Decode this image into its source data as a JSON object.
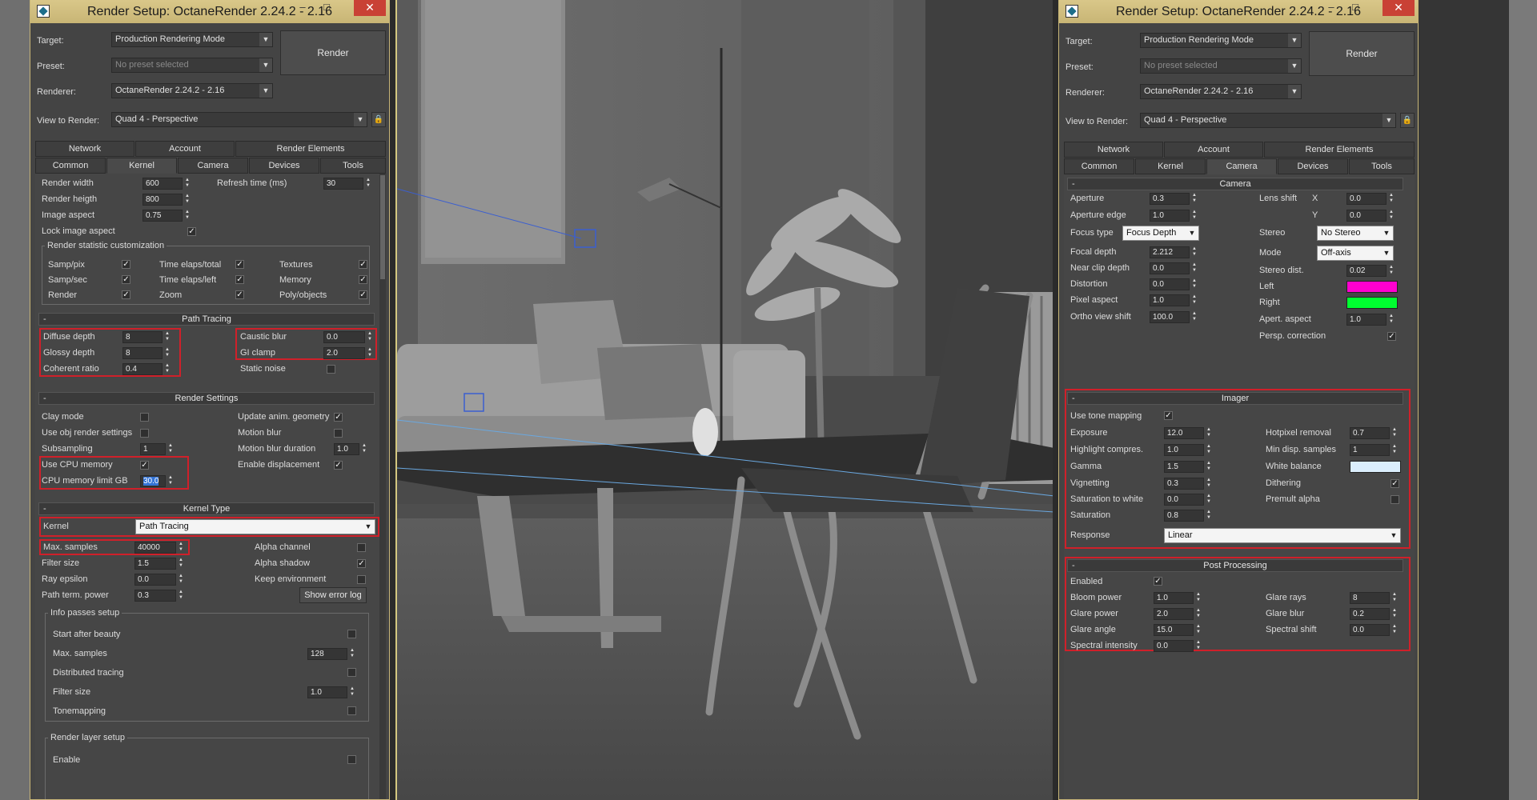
{
  "left_window": {
    "title": "Render Setup: OctaneRender 2.24.2 - 2.16",
    "target_label": "Target:",
    "target_value": "Production Rendering Mode",
    "preset_label": "Preset:",
    "preset_value": "No preset selected",
    "renderer_label": "Renderer:",
    "renderer_value": "OctaneRender 2.24.2 - 2.16",
    "view_label": "View to Render:",
    "view_value": "Quad 4 - Perspective",
    "render_button": "Render",
    "tabs_row1": [
      "Network",
      "Account",
      "Render Elements"
    ],
    "tabs_row2": [
      "Common",
      "Kernel",
      "Camera",
      "Devices",
      "Tools"
    ],
    "active_tab": "Kernel",
    "render_width_label": "Render width",
    "render_width": "600",
    "render_height_label": "Render heigth",
    "render_height": "800",
    "image_aspect_label": "Image aspect",
    "image_aspect": "0.75",
    "lock_aspect_label": "Lock image aspect",
    "refresh_label": "Refresh time (ms)",
    "refresh_value": "30",
    "stat_group_title": "Render statistic customization",
    "stat_items": [
      "Samp/pix",
      "Time elaps/total",
      "Textures",
      "Samp/sec",
      "Time elaps/left",
      "Memory",
      "Render",
      "Zoom",
      "Poly/objects"
    ],
    "path_tracing_title": "Path Tracing",
    "diffuse_depth_label": "Diffuse depth",
    "diffuse_depth": "8",
    "glossy_depth_label": "Glossy depth",
    "glossy_depth": "8",
    "coherent_ratio_label": "Coherent ratio",
    "coherent_ratio": "0.4",
    "caustic_blur_label": "Caustic blur",
    "caustic_blur": "0.0",
    "gi_clamp_label": "GI clamp",
    "gi_clamp": "2.0",
    "static_noise_label": "Static noise",
    "render_settings_title": "Render Settings",
    "clay_mode_label": "Clay mode",
    "use_obj_label": "Use obj render settings",
    "subsampling_label": "Subsampling",
    "subsampling": "1",
    "use_cpu_label": "Use CPU memory",
    "cpu_limit_label": "CPU memory limit GB",
    "cpu_limit": "30.0",
    "update_anim_label": "Update anim. geometry",
    "motion_blur_label": "Motion blur",
    "motion_blur_dur_label": "Motion blur duration",
    "motion_blur_dur": "1.0",
    "enable_disp_label": "Enable displacement",
    "kernel_type_title": "Kernel Type",
    "kernel_label": "Kernel",
    "kernel_value": "Path Tracing",
    "max_samples_label": "Max. samples",
    "max_samples": "40000",
    "filter_size_label": "Filter size",
    "filter_size": "1.5",
    "ray_epsilon_label": "Ray epsilon",
    "ray_epsilon": "0.0",
    "path_term_label": "Path term. power",
    "path_term": "0.3",
    "alpha_channel_label": "Alpha channel",
    "alpha_shadow_label": "Alpha shadow",
    "keep_env_label": "Keep environment",
    "show_error_log": "Show error log",
    "info_passes_title": "Info passes setup",
    "start_after_beauty_label": "Start after beauty",
    "info_max_samples_label": "Max. samples",
    "info_max_samples": "128",
    "distributed_label": "Distributed tracing",
    "info_filter_label": "Filter size",
    "info_filter": "1.0",
    "tonemapping_label": "Tonemapping",
    "render_layer_title": "Render layer setup",
    "enable_label": "Enable"
  },
  "right_window": {
    "title": "Render Setup: OctaneRender 2.24.2 - 2.16",
    "target_label": "Target:",
    "target_value": "Production Rendering Mode",
    "preset_label": "Preset:",
    "preset_value": "No preset selected",
    "renderer_label": "Renderer:",
    "renderer_value": "OctaneRender 2.24.2 - 2.16",
    "view_label": "View to Render:",
    "view_value": "Quad 4 - Perspective",
    "render_button": "Render",
    "tabs_row1": [
      "Network",
      "Account",
      "Render Elements"
    ],
    "tabs_row2": [
      "Common",
      "Kernel",
      "Camera",
      "Devices",
      "Tools"
    ],
    "active_tab": "Camera",
    "camera_title": "Camera",
    "aperture_label": "Aperture",
    "aperture": "0.3",
    "aperture_edge_label": "Aperture edge",
    "aperture_edge": "1.0",
    "focus_type_label": "Focus type",
    "focus_type": "Focus Depth",
    "focal_depth_label": "Focal depth",
    "focal_depth": "2.212",
    "near_clip_label": "Near clip depth",
    "near_clip": "0.0",
    "distortion_label": "Distortion",
    "distortion": "0.0",
    "pixel_aspect_label": "Pixel aspect",
    "pixel_aspect": "1.0",
    "ortho_label": "Ortho view shift",
    "ortho": "100.0",
    "lens_shift_label": "Lens shift",
    "x_label": "X",
    "lens_x": "0.0",
    "y_label": "Y",
    "lens_y": "0.0",
    "stereo_label": "Stereo",
    "stereo": "No Stereo",
    "mode_label": "Mode",
    "mode": "Off-axis",
    "stereo_dist_label": "Stereo dist.",
    "stereo_dist": "0.02",
    "left_label": "Left",
    "left_color": "#ff00d0",
    "right_label": "Right",
    "right_color": "#00ff30",
    "apert_aspect_label": "Apert. aspect",
    "apert_aspect": "1.0",
    "persp_corr_label": "Persp. correction",
    "imager_title": "Imager",
    "use_tone_label": "Use tone mapping",
    "exposure_label": "Exposure",
    "exposure": "12.0",
    "highlight_label": "Highlight compres.",
    "highlight": "1.0",
    "gamma_label": "Gamma",
    "gamma": "1.5",
    "vignetting_label": "Vignetting",
    "vignetting": "0.3",
    "sat_white_label": "Saturation to white",
    "sat_white": "0.0",
    "saturation_label": "Saturation",
    "saturation": "0.8",
    "response_label": "Response",
    "response": "Linear",
    "hotpixel_label": "Hotpixel removal",
    "hotpixel": "0.7",
    "min_disp_label": "Min disp. samples",
    "min_disp": "1",
    "white_balance_label": "White balance",
    "white_balance_color": "#dbeefc",
    "dithering_label": "Dithering",
    "premult_label": "Premult alpha",
    "post_title": "Post Processing",
    "enabled_label": "Enabled",
    "bloom_label": "Bloom power",
    "bloom": "1.0",
    "glare_power_label": "Glare power",
    "glare_power": "2.0",
    "glare_angle_label": "Glare angle",
    "glare_angle": "15.0",
    "spectral_int_label": "Spectral intensity",
    "spectral_int": "0.0",
    "glare_rays_label": "Glare rays",
    "glare_rays": "8",
    "glare_blur_label": "Glare blur",
    "glare_blur": "0.2",
    "spectral_shift_label": "Spectral shift",
    "spectral_shift": "0.0"
  },
  "colors": {
    "highlight_red": "#d0202a",
    "title_gold": "#d9c789",
    "panel_bg": "#444444"
  }
}
